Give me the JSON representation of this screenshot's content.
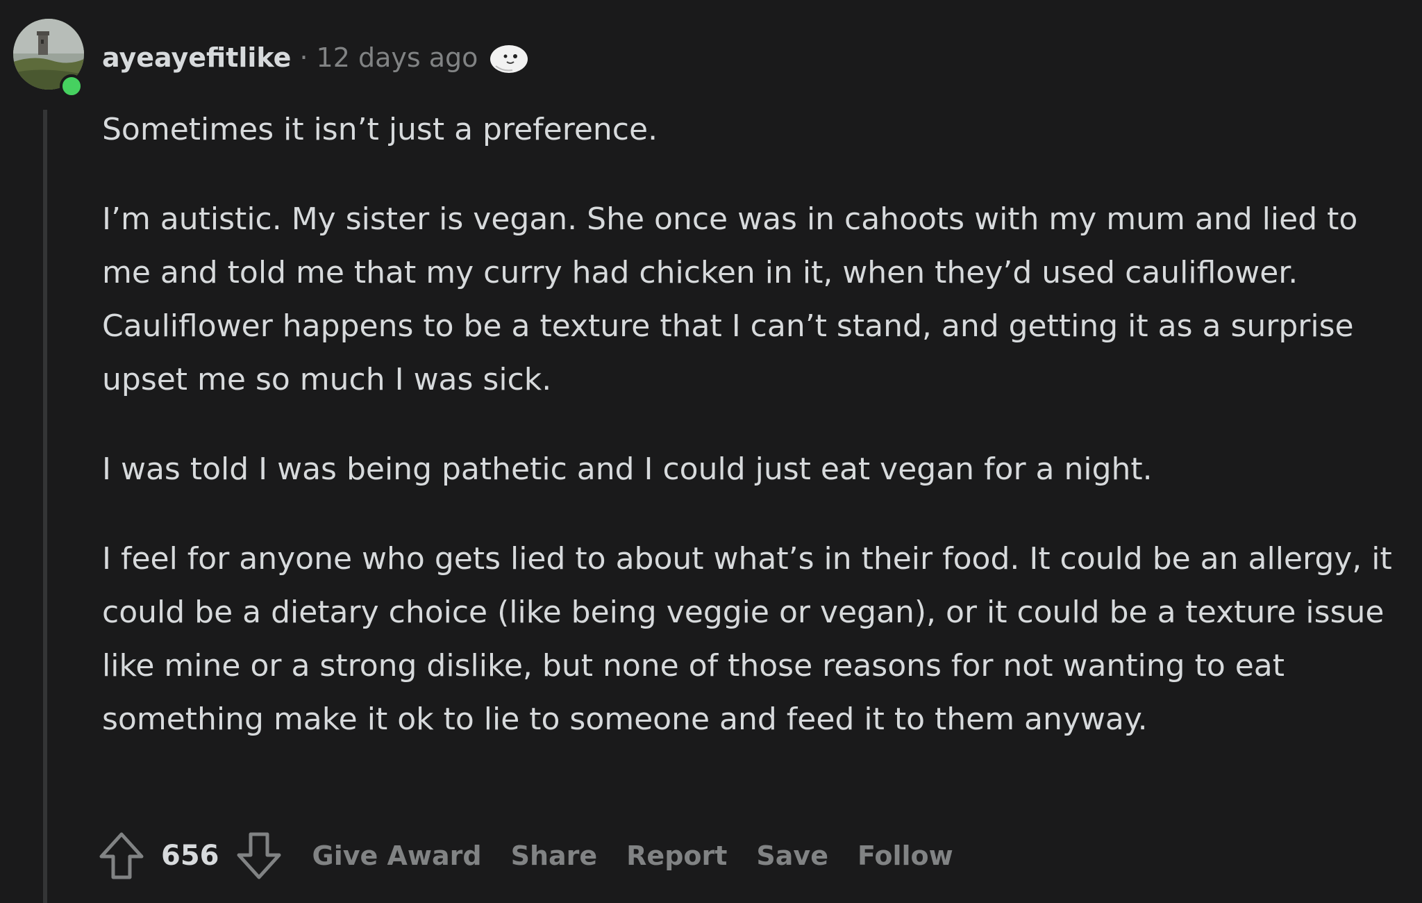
{
  "comment": {
    "username": "ayeayefitlike",
    "separator": "·",
    "timestamp": "12 days ago",
    "paragraphs": [
      "Sometimes it isn’t just a preference.",
      "I’m autistic. My sister is vegan. She once was in cahoots with my mum and lied to me and told me that my curry had chicken in it, when they’d used cauliflower. Cauliflower happens to be a texture that I can’t stand, and getting it as a surprise upset me so much I was sick.",
      "I was told I was being pathetic and I could just eat vegan for a night.",
      "I feel for anyone who gets lied to about what’s in their food. It could be an allergy, it could be a dietary choice (like being veggie or vegan), or it could be a texture issue like mine or a strong dislike, but none of those reasons for not wanting to eat something make it ok to lie to someone and feed it to them anyway."
    ],
    "score": "656",
    "actions": {
      "give_award": "Give Award",
      "share": "Share",
      "report": "Report",
      "save": "Save",
      "follow": "Follow"
    },
    "icons": {
      "avatar": "avatar-image",
      "award": "seal-award-icon",
      "upvote": "upvote-arrow-icon",
      "downvote": "downvote-arrow-icon"
    },
    "colors": {
      "background": "#1a1a1b",
      "text": "#d7dadc",
      "muted": "#818384",
      "online": "#46d160",
      "thread_line": "#343536"
    }
  }
}
